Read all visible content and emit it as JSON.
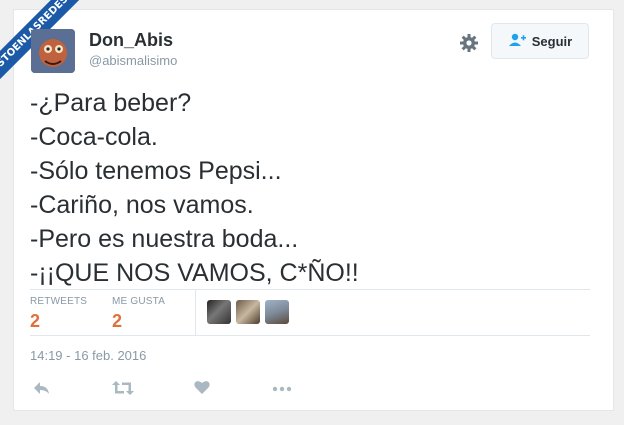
{
  "watermark": {
    "text": "VISTOENLASREDES"
  },
  "user": {
    "display_name": "Don_Abis",
    "handle": "@abismalisimo"
  },
  "follow": {
    "label": "Seguir",
    "icon": "add-user-icon"
  },
  "settings": {
    "icon": "gear-icon"
  },
  "tweet": {
    "lines": [
      "-¿Para beber?",
      "-Coca-cola.",
      "-Sólo tenemos Pepsi...",
      "-Cariño, nos vamos.",
      "-Pero es nuestra boda...",
      "-¡¡QUE NOS VAMOS, C*ÑO!!"
    ]
  },
  "stats": {
    "retweets_label": "RETWEETS",
    "retweets_value": "2",
    "likes_label": "ME GUSTA",
    "likes_value": "2"
  },
  "timestamp": "14:19 - 16 feb. 2016",
  "actions": [
    "reply-icon",
    "retweet-icon",
    "heart-icon",
    "more-icon"
  ],
  "colors": {
    "accent": "#e0703a",
    "muted": "#8899a6",
    "text": "#292f33",
    "watermark": "#1a5aa7"
  }
}
